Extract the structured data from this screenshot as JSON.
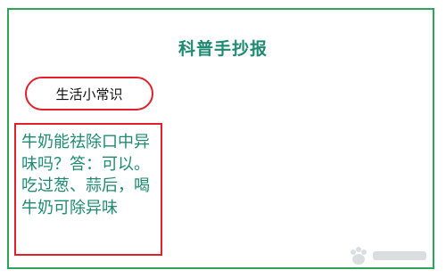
{
  "page": {
    "title": "科普手抄报",
    "section_label": "生活小常识",
    "content": "牛奶能祛除口中异味吗？答：可以。吃过葱、蒜后，喝牛奶可除异味"
  },
  "colors": {
    "frame_border": "#2fa35a",
    "title_text": "#1e8a72",
    "body_text": "#1e8a72",
    "accent_red": "#e0212a"
  }
}
